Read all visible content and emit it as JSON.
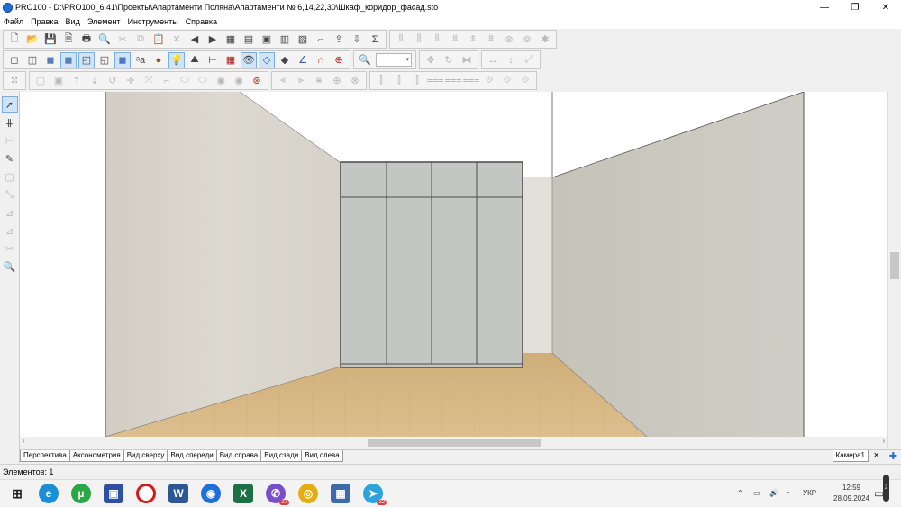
{
  "window": {
    "title": "PRO100 - D:\\PRO100_6.41\\Проекты\\Апартаменти Поляна\\Апартаменти № 6,14,22,30\\Шкаф_коридор_фасад.sto",
    "minimize_glyph": "—",
    "restore_glyph": "❐",
    "close_glyph": "✕"
  },
  "menu": [
    "Файл",
    "Правка",
    "Вид",
    "Элемент",
    "Инструменты",
    "Справка"
  ],
  "toolbar": {
    "zoom_combo_value": "▾",
    "sum_glyph": "Σ"
  },
  "view_tabs": [
    "Перспектива",
    "Аксонометрия",
    "Вид сверху",
    "Вид спереди",
    "Вид справа",
    "Вид сзади",
    "Вид слева"
  ],
  "camera_tab": "Камера1",
  "status": {
    "elements": "Элементов: 1"
  },
  "taskbar": {
    "viber_badge": "27",
    "telegram_badge": "22",
    "language": "УКР",
    "time": "12:59",
    "date": "28.09.2024",
    "notifications_badge": "2"
  },
  "colors": {
    "accent": "#1e6fd9",
    "floor": "#d7b784",
    "left_wall": "#d9d6cf",
    "right_wall": "#c9c8be",
    "cabinet": "#c4c6c4",
    "pressed_button": "#cfe4f8"
  }
}
